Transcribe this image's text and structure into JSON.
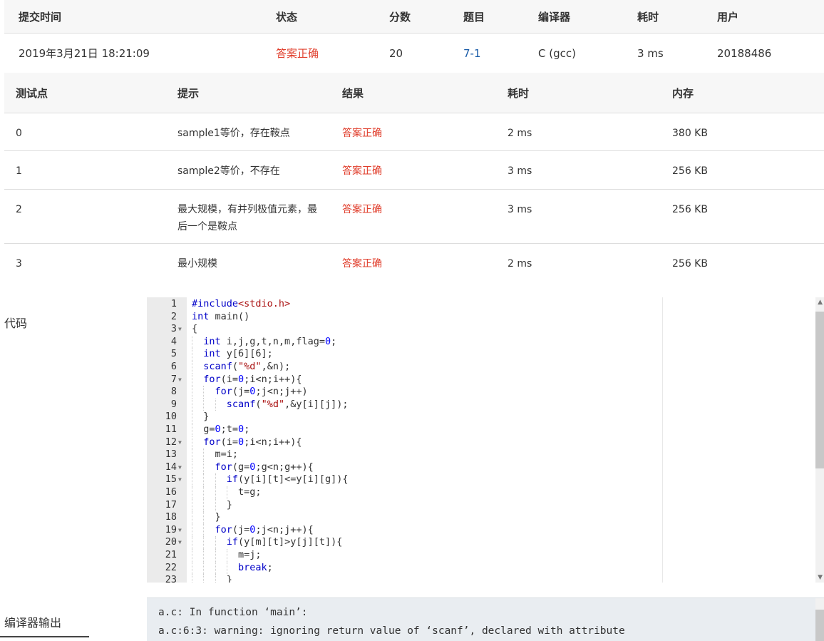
{
  "summary": {
    "headers": [
      "提交时间",
      "状态",
      "分数",
      "题目",
      "编译器",
      "耗时",
      "用户"
    ],
    "row": {
      "time": "2019年3月21日 18:21:09",
      "status": "答案正确",
      "score": "20",
      "problem": "7-1",
      "compiler": "C (gcc)",
      "elapsed": "3 ms",
      "user": "20188486"
    }
  },
  "tests": {
    "headers": [
      "测试点",
      "提示",
      "结果",
      "耗时",
      "内存"
    ],
    "rows": [
      {
        "id": "0",
        "hint": "sample1等价，存在鞍点",
        "result": "答案正确",
        "time": "2 ms",
        "mem": "380 KB"
      },
      {
        "id": "1",
        "hint": "sample2等价，不存在",
        "result": "答案正确",
        "time": "3 ms",
        "mem": "256 KB"
      },
      {
        "id": "2",
        "hint": "最大规模，有并列极值元素，最后一个是鞍点",
        "result": "答案正确",
        "time": "3 ms",
        "mem": "256 KB"
      },
      {
        "id": "3",
        "hint": "最小规模",
        "result": "答案正确",
        "time": "2 ms",
        "mem": "256 KB"
      }
    ]
  },
  "code_label": "代码",
  "code_lines": [
    "#include<stdio.h>",
    "int main()",
    "{",
    "  int i,j,g,t,n,m,flag=0;",
    "  int y[6][6];",
    "  scanf(\"%d\",&n);",
    "  for(i=0;i<n;i++){",
    "    for(j=0;j<n;j++)",
    "      scanf(\"%d\",&y[i][j]);",
    "  }",
    "  g=0;t=0;",
    "  for(i=0;i<n;i++){",
    "    m=i;",
    "    for(g=0;g<n;g++){",
    "      if(y[i][t]<=y[i][g]){",
    "        t=g;",
    "      }",
    "    }",
    "    for(j=0;j<n;j++){",
    "      if(y[m][t]>y[j][t]){",
    "        m=j;",
    "        break;",
    "      }"
  ],
  "fold_lines": [
    3,
    7,
    12,
    14,
    15,
    19,
    20
  ],
  "output_label": "编译器输出",
  "output_lines": [
    "a.c: In function ‘main’:",
    "a.c:6:3: warning: ignoring return value of ‘scanf’, declared with attribute"
  ]
}
